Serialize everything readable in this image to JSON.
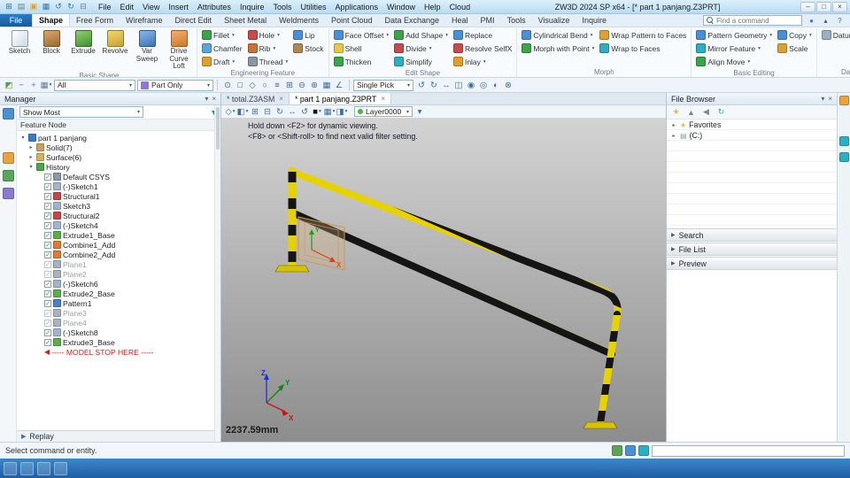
{
  "colors": {
    "accent": "#1a6fb5",
    "safety_yellow": "#e6d200",
    "stripe_black": "#151515",
    "model_stop_red": "#e01515"
  },
  "titlebar": {
    "title": "ZW3D 2024 SP x64 - [* part 1 panjang.Z3PRT]",
    "menus": [
      "File",
      "Edit",
      "View",
      "Insert",
      "Attributes",
      "Inquire",
      "Tools",
      "Utilities",
      "Applications",
      "Window",
      "Help",
      "Cloud"
    ],
    "qat_icons": [
      {
        "name": "app-icon",
        "glyph": "⊞",
        "color": "#2f6fc1"
      },
      {
        "name": "new-file-icon",
        "glyph": "▤",
        "color": "#6a7a8a"
      },
      {
        "name": "open-folder-icon",
        "glyph": "▣",
        "color": "#e0a030"
      },
      {
        "name": "save-icon",
        "glyph": "▦",
        "color": "#3a6ea5"
      },
      {
        "name": "undo-icon",
        "glyph": "↺",
        "color": "#3a6ea5"
      },
      {
        "name": "redo-icon",
        "glyph": "↻",
        "color": "#3a6ea5"
      },
      {
        "name": "print-icon",
        "glyph": "⊟",
        "color": "#6a7a8a"
      }
    ],
    "window_buttons": [
      {
        "name": "minimize-icon",
        "glyph": "–"
      },
      {
        "name": "maximize-icon",
        "glyph": "□"
      },
      {
        "name": "close-icon",
        "glyph": "×"
      }
    ]
  },
  "tabrow": {
    "file_button": "File",
    "tabs": [
      "Shape",
      "Free Form",
      "Wireframe",
      "Direct Edit",
      "Sheet Metal",
      "Weldments",
      "Point Cloud",
      "Data Exchange",
      "Heal",
      "PMI",
      "Tools",
      "Visualize",
      "Inquire"
    ],
    "active_tab": "Shape",
    "search_placeholder": "Find a command",
    "right_icons": [
      {
        "name": "account-icon",
        "glyph": "●",
        "color": "#3a7fd0"
      },
      {
        "name": "collapse-ribbon-icon",
        "glyph": "▴",
        "color": "#456"
      },
      {
        "name": "help-icon",
        "glyph": "?",
        "color": "#2a6fb5"
      }
    ]
  },
  "ribbon": {
    "groups": [
      {
        "label": "Basic Shape",
        "type": "large",
        "items": [
          {
            "label": "Sketch",
            "icon": "sketch"
          },
          {
            "label": "Block",
            "icon": "block"
          },
          {
            "label": "Extrude",
            "icon": "extrude"
          },
          {
            "label": "Revolve",
            "icon": "revolve"
          },
          {
            "label": "Var Sweep",
            "icon": "sweep"
          },
          {
            "label": "Drive Curve Loft",
            "icon": "loft"
          }
        ]
      },
      {
        "label": "Engineering Feature",
        "type": "small",
        "columns": [
          [
            {
              "label": "Fillet",
              "arrow": true,
              "c": "#3aa54a"
            },
            {
              "label": "Chamfer",
              "c": "#57a7d8"
            },
            {
              "label": "Draft",
              "arrow": true,
              "c": "#e0a030"
            }
          ],
          [
            {
              "label": "Hole",
              "arrow": true,
              "c": "#c84b4b"
            },
            {
              "label": "Rib",
              "arrow": true,
              "c": "#d07030"
            },
            {
              "label": "Thread",
              "arrow": true,
              "c": "#8a96a2"
            }
          ],
          [
            {
              "label": "Lip",
              "c": "#4a90d9"
            },
            {
              "label": "Stock",
              "c": "#b08850"
            }
          ]
        ]
      },
      {
        "label": "Edit Shape",
        "type": "small",
        "columns": [
          [
            {
              "label": "Face Offset",
              "arrow": true,
              "c": "#4a90d9"
            },
            {
              "label": "Shell",
              "c": "#e8c840"
            },
            {
              "label": "Thicken",
              "c": "#3aa54a"
            }
          ],
          [
            {
              "label": "Add Shape",
              "arrow": true,
              "c": "#3aa54a"
            },
            {
              "label": "Divide",
              "arrow": true,
              "c": "#c84b4b"
            },
            {
              "label": "Simplify",
              "c": "#2ab0c5"
            }
          ],
          [
            {
              "label": "Replace",
              "c": "#4a90d9"
            },
            {
              "label": "Resolve SelfX",
              "c": "#c84b4b"
            },
            {
              "label": "Inlay",
              "arrow": true,
              "c": "#e0a030"
            }
          ]
        ]
      },
      {
        "label": "Morph",
        "type": "small",
        "columns": [
          [
            {
              "label": "Cylindrical Bend",
              "arrow": true,
              "c": "#4a90d9"
            },
            {
              "label": "Morph with Point",
              "arrow": true,
              "c": "#3aa54a"
            }
          ],
          [
            {
              "label": "Wrap Pattern to Faces",
              "c": "#e0a030"
            },
            {
              "label": "Wrap to Faces",
              "c": "#2ab0c5"
            }
          ]
        ]
      },
      {
        "label": "Basic Editing",
        "type": "small",
        "columns": [
          [
            {
              "label": "Pattern Geometry",
              "arrow": true,
              "c": "#4a90d9"
            },
            {
              "label": "Mirror Feature",
              "arrow": true,
              "c": "#2ab0c5"
            },
            {
              "label": "Align Move",
              "arrow": true,
              "c": "#3aa54a"
            }
          ],
          [
            {
              "label": "Copy",
              "arrow": true,
              "c": "#4a90d9"
            },
            {
              "label": "Scale",
              "c": "#e0a030"
            }
          ]
        ]
      },
      {
        "label": "Datum",
        "type": "small",
        "columns": [
          [
            {
              "label": "Datum Plane",
              "arrow": true,
              "c": "#9ab0c4"
            }
          ]
        ]
      }
    ]
  },
  "seltoolbar": {
    "left_icons": [
      {
        "name": "all-filter-icon",
        "glyph": "◩",
        "color": "#5a9e46"
      },
      {
        "name": "remove-filter-icon",
        "glyph": "−",
        "color": "#d04040"
      },
      {
        "name": "add-filter-icon",
        "glyph": "+",
        "color": "#3a7fd0"
      },
      {
        "name": "filter-list-icon",
        "glyph": "▦",
        "color": "#5a7f9e",
        "arrow": true
      }
    ],
    "entity_filter": "All",
    "display_filter": "Part Only",
    "mid_icons": [
      {
        "name": "pick-point-icon",
        "glyph": "⊙"
      },
      {
        "name": "pick-box-icon",
        "glyph": "□"
      },
      {
        "name": "pick-polygon-icon",
        "glyph": "◇"
      },
      {
        "name": "pick-circle-icon",
        "glyph": "○"
      },
      {
        "name": "pick-chain-icon",
        "glyph": "≡"
      },
      {
        "name": "pick-all-icon",
        "glyph": "⊞"
      },
      {
        "name": "pick-invert-icon",
        "glyph": "⊖"
      },
      {
        "name": "snap-icon",
        "glyph": "⊕"
      },
      {
        "name": "grid-snap-icon",
        "glyph": "▦"
      },
      {
        "name": "angle-snap-icon",
        "glyph": "∠"
      }
    ],
    "pick_mode": "Single Pick",
    "right_icons": [
      {
        "name": "undo-pick-icon",
        "glyph": "↺"
      },
      {
        "name": "redo-pick-icon",
        "glyph": "↻"
      },
      {
        "name": "measure-icon",
        "glyph": "↔"
      },
      {
        "name": "section-icon",
        "glyph": "◫"
      },
      {
        "name": "show-icon",
        "glyph": "◉"
      },
      {
        "name": "hide-icon",
        "glyph": "◎"
      },
      {
        "name": "isolate-icon",
        "glyph": "◐"
      },
      {
        "name": "display-settings-icon",
        "glyph": "⊗"
      }
    ]
  },
  "doc_tabs": [
    {
      "label": "* total.Z3ASM",
      "active": false
    },
    {
      "label": "* part 1 panjang.Z3PRT",
      "active": true
    }
  ],
  "manager": {
    "header": "Manager",
    "filter_value": "Show Most",
    "column_header": "Feature Node",
    "replay_label": "Replay",
    "dock_icons": [
      {
        "name": "manager-tab-icon",
        "bg": "#4a90d9"
      },
      {
        "name": "roles-tab-icon",
        "bg": "#e8a33d"
      },
      {
        "name": "visual-manager-tab-icon",
        "bg": "#5aa55a"
      },
      {
        "name": "assembly-tab-icon",
        "bg": "#8a7ad0"
      }
    ],
    "tree": [
      {
        "label": "part 1 panjang",
        "level": 0,
        "expander": "open",
        "icon": "part"
      },
      {
        "label": "Solid(7)",
        "level": 1,
        "expander": "closed",
        "icon": "solid"
      },
      {
        "label": "Surface(6)",
        "level": 1,
        "expander": "closed",
        "icon": "surface"
      },
      {
        "label": "History",
        "level": 1,
        "expander": "open",
        "icon": "history"
      },
      {
        "label": "Default CSYS",
        "level": 2,
        "icon": "csys",
        "check": true
      },
      {
        "label": "(-)Sketch1",
        "level": 2,
        "icon": "sketch",
        "check": true
      },
      {
        "label": "Structural1",
        "level": 2,
        "icon": "structural",
        "check": true
      },
      {
        "label": "Sketch3",
        "level": 2,
        "icon": "sketch",
        "check": true
      },
      {
        "label": "Structural2",
        "level": 2,
        "icon": "structural",
        "check": true
      },
      {
        "label": "(-)Sketch4",
        "level": 2,
        "icon": "sketch",
        "check": true
      },
      {
        "label": "Extrude1_Base",
        "level": 2,
        "icon": "extrude",
        "check": true
      },
      {
        "label": "Combine1_Add",
        "level": 2,
        "icon": "combine",
        "check": true
      },
      {
        "label": "Combine2_Add",
        "level": 2,
        "icon": "combine",
        "check": true
      },
      {
        "label": "Plane1",
        "level": 2,
        "icon": "plane",
        "check": true,
        "muted": true
      },
      {
        "label": "Plane2",
        "level": 2,
        "icon": "plane",
        "check": true,
        "muted": true
      },
      {
        "label": "(-)Sketch6",
        "level": 2,
        "icon": "sketch",
        "check": true
      },
      {
        "label": "Extrude2_Base",
        "level": 2,
        "icon": "extrude",
        "check": true
      },
      {
        "label": "Pattern1",
        "level": 2,
        "icon": "pattern",
        "check": true
      },
      {
        "label": "Plane3",
        "level": 2,
        "icon": "plane",
        "check": true,
        "muted": true
      },
      {
        "label": "Plane4",
        "level": 2,
        "icon": "plane",
        "check": true,
        "muted": true
      },
      {
        "label": "(-)Sketch8",
        "level": 2,
        "icon": "sketch",
        "check": true
      },
      {
        "label": "Extrude3_Base",
        "level": 2,
        "icon": "extrude",
        "check": true
      },
      {
        "label": "----- MODEL STOP HERE -----",
        "level": 2,
        "icon": "stop",
        "style": "stop"
      }
    ]
  },
  "canvas": {
    "hint_line1": "Hold down <F2> for dynamic viewing.",
    "hint_line2": "<F8> or <Shift-roll> to find next valid filter setting.",
    "measurement": "2237.59mm",
    "layer": "Layer0000",
    "axes": {
      "x": "X",
      "y": "Y",
      "z": "Z"
    },
    "sketch_axis_x": "X",
    "sketch_axis_y": "Y",
    "view_icons": [
      {
        "name": "view-orient-icon",
        "glyph": "◇",
        "arrow": true
      },
      {
        "name": "render-mode-icon",
        "glyph": "◧",
        "arrow": true
      },
      {
        "name": "zoom-all-icon",
        "glyph": "⊞"
      },
      {
        "name": "zoom-window-icon",
        "glyph": "⊟"
      },
      {
        "name": "rotate-view-icon",
        "glyph": "↻"
      },
      {
        "name": "pan-view-icon",
        "glyph": "↔"
      },
      {
        "name": "previous-view-icon",
        "glyph": "↺"
      },
      {
        "name": "face-color-icon",
        "glyph": "■",
        "color": "#111",
        "arrow": true
      },
      {
        "name": "edge-display-icon",
        "glyph": "▦",
        "arrow": true
      },
      {
        "name": "background-icon",
        "glyph": "◨",
        "arrow": true
      }
    ]
  },
  "file_browser": {
    "header": "File Browser",
    "toolbar_icons": [
      {
        "name": "favorites-star-icon",
        "glyph": "★",
        "color": "#e8b93e"
      },
      {
        "name": "folder-up-icon",
        "glyph": "▲",
        "color": "#7a8a9a"
      },
      {
        "name": "back-icon",
        "glyph": "◀",
        "color": "#7a8a9a"
      },
      {
        "name": "refresh-icon",
        "glyph": "↻",
        "color": "#2ab0c5"
      }
    ],
    "tree": [
      {
        "label": "Favorites",
        "glyph": "★",
        "color": "#e8b93e",
        "icon": "star-icon"
      },
      {
        "label": "(C:)",
        "glyph": "▤",
        "color": "#8a9aaa",
        "icon": "drive-icon"
      }
    ],
    "sections": [
      "Search",
      "File List",
      "Preview"
    ],
    "strip_icons": [
      {
        "name": "folder-tab-icon",
        "bg": "#e8a33d"
      },
      {
        "name": "reuse-library-icon",
        "bg": "#2ab0c5"
      },
      {
        "name": "history-tab-icon",
        "bg": "#2ab0c5"
      }
    ]
  },
  "statusbar": {
    "message": "Select command or entity.",
    "right_icons": [
      {
        "name": "point-readout-icon",
        "bg": "#5aa55a"
      },
      {
        "name": "units-icon",
        "bg": "#4a90d9"
      },
      {
        "name": "filter-status-icon",
        "bg": "#2ab0c5"
      }
    ]
  },
  "taskbar": {
    "icons": [
      {
        "name": "start-icon"
      },
      {
        "name": "taskbar-app-icon-1"
      },
      {
        "name": "taskbar-app-icon-2"
      },
      {
        "name": "taskbar-app-icon-3"
      }
    ]
  }
}
